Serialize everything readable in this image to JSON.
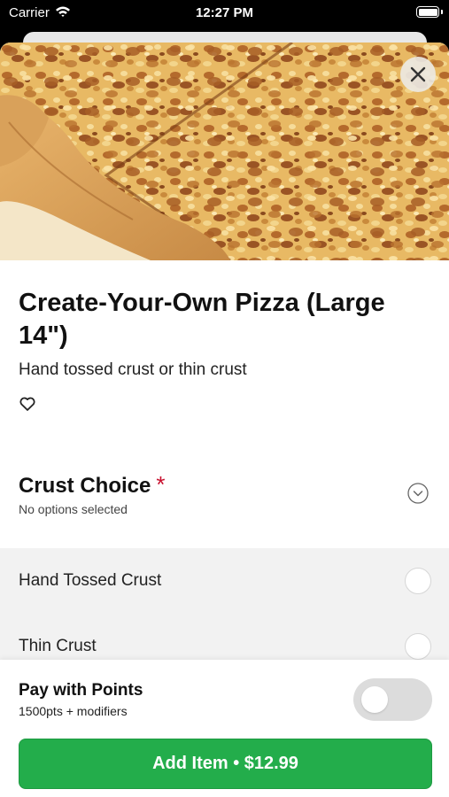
{
  "status_bar": {
    "carrier": "Carrier",
    "time": "12:27 PM"
  },
  "item": {
    "title": "Create-Your-Own Pizza (Large 14\")",
    "subtitle": "Hand tossed crust or thin crust"
  },
  "modifier_group": {
    "title": "Crust Choice",
    "required_marker": "*",
    "status": "No options selected",
    "options": [
      {
        "label": "Hand Tossed Crust",
        "selected": false
      },
      {
        "label": "Thin Crust",
        "selected": false
      }
    ]
  },
  "footer": {
    "points_title": "Pay with Points",
    "points_subtitle": "1500pts + modifiers",
    "points_toggle_on": false,
    "add_button_label": "Add Item • $12.99"
  },
  "colors": {
    "accent_green": "#23ad4b",
    "required_red": "#c8102e"
  },
  "icons": {
    "close": "close-icon",
    "favorite": "heart-outline-icon",
    "expand": "chevron-down-circle-icon",
    "wifi": "wifi-icon",
    "battery": "battery-icon"
  }
}
